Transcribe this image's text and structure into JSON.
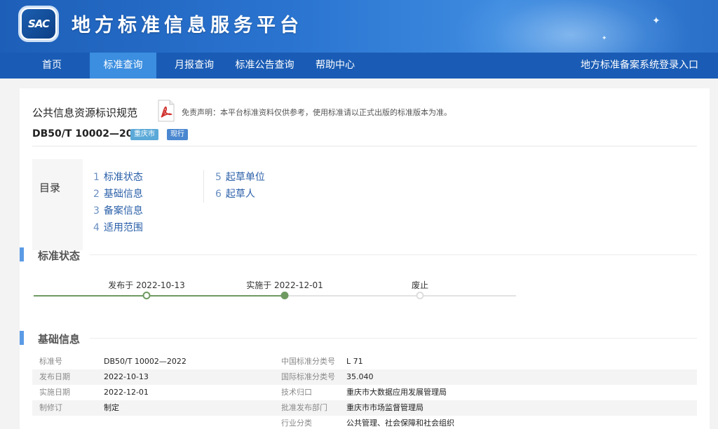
{
  "header": {
    "logo_text": "SAC",
    "site_title": "地方标准信息服务平台"
  },
  "nav": {
    "items": [
      "首页",
      "标准查询",
      "月报查询",
      "标准公告查询",
      "帮助中心"
    ],
    "active_index": 1,
    "login_link": "地方标准备案系统登录入口"
  },
  "doc": {
    "title": "公共信息资源标识规范",
    "disclaimer": "免责声明：本平台标准资料仅供参考，使用标准请以正式出版的标准版本为准。",
    "code": "DB50/T 10002—2022",
    "region_badge": "重庆市",
    "status_badge": "现行"
  },
  "toc": {
    "title": "目录",
    "items": [
      {
        "num": "1",
        "label": "标准状态"
      },
      {
        "num": "2",
        "label": "基础信息"
      },
      {
        "num": "3",
        "label": "备案信息"
      },
      {
        "num": "4",
        "label": "适用范围"
      },
      {
        "num": "5",
        "label": "起草单位"
      },
      {
        "num": "6",
        "label": "起草人"
      }
    ]
  },
  "status_section": {
    "title": "标准状态",
    "timeline": [
      {
        "label": "发布于 2022-10-13",
        "reached": true
      },
      {
        "label": "实施于 2022-12-01",
        "reached": true
      },
      {
        "label": "废止",
        "reached": false
      }
    ]
  },
  "basic_section": {
    "title": "基础信息",
    "rows": [
      {
        "k1": "标准号",
        "v1": "DB50/T 10002—2022",
        "k2": "中国标准分类号",
        "v2": "L 71"
      },
      {
        "k1": "发布日期",
        "v1": "2022-10-13",
        "k2": "国际标准分类号",
        "v2": "35.040"
      },
      {
        "k1": "实施日期",
        "v1": "2022-12-01",
        "k2": "技术归口",
        "v2": "重庆市大数据应用发展管理局"
      },
      {
        "k1": "制修订",
        "v1": "制定",
        "k2": "批准发布部门",
        "v2": "重庆市市场监督管理局"
      },
      {
        "k1": "",
        "v1": "",
        "k2": "行业分类",
        "v2": "公共管理、社会保障和社会组织"
      }
    ]
  },
  "colors": {
    "nav_bg": "#1a5cb5",
    "nav_active": "#3b8ee0",
    "accent": "#5b9be6",
    "timeline_reached": "#6f9a62",
    "timeline_pending": "#dddddd"
  }
}
